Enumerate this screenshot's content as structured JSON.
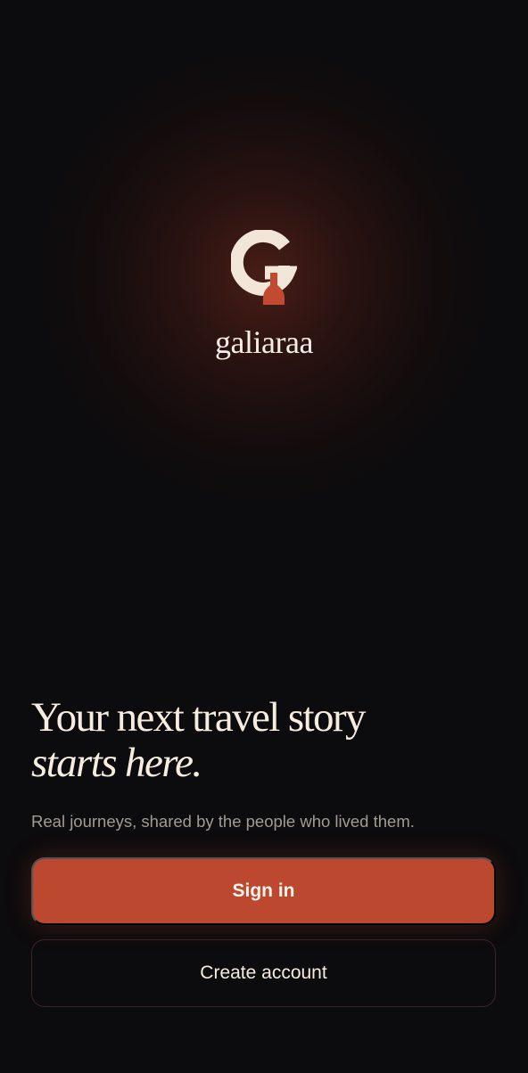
{
  "brand": {
    "name": "galiaraa",
    "logo_icon": "g-monogram-logo-icon",
    "accent_color": "#bc4830",
    "logo_color": "#f1e6d8"
  },
  "hero": {
    "headline_line1": "Your next travel story",
    "headline_line2": "starts here.",
    "subtitle": "Real journeys, shared by the people who lived them."
  },
  "actions": {
    "sign_in_label": "Sign in",
    "create_account_label": "Create account"
  }
}
